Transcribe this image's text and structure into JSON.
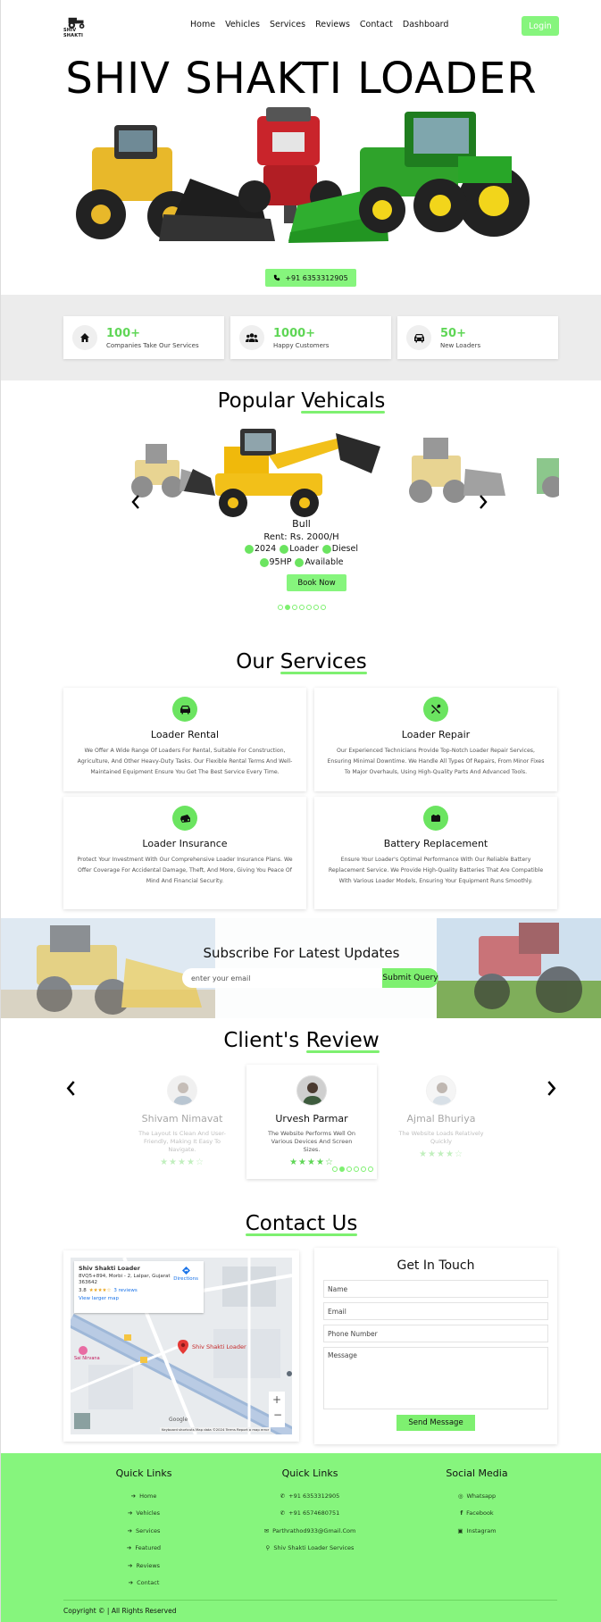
{
  "brand": {
    "logo_text": "SHIV SHAKTI"
  },
  "nav": {
    "items": [
      {
        "label": "Home"
      },
      {
        "label": "Vehicles"
      },
      {
        "label": "Services"
      },
      {
        "label": "Reviews"
      },
      {
        "label": "Contact"
      },
      {
        "label": "Dashboard"
      }
    ],
    "login_label": "Login"
  },
  "hero": {
    "title": "SHIV SHAKTI LOADER",
    "phone": "+91 6353312905"
  },
  "stats": [
    {
      "icon": "home-icon",
      "value": "100+",
      "label": "Companies Take Our Services"
    },
    {
      "icon": "users-icon",
      "value": "1000+",
      "label": "Happy Customers"
    },
    {
      "icon": "car-icon",
      "value": "50+",
      "label": "New Loaders"
    }
  ],
  "vehicles": {
    "title_a": "Popular",
    "title_b": "Vehicals",
    "current": {
      "name": "Bull",
      "rent": "Rent: Rs. 2000/H",
      "tags_row1": [
        "2024",
        "Loader",
        "Diesel"
      ],
      "tags_row2": [
        "95HP",
        "Available"
      ]
    },
    "book_label": "Book Now",
    "indicator_count": 7,
    "active_indicator": 1
  },
  "services": {
    "title_a": "Our",
    "title_b": "Services",
    "items": [
      {
        "icon": "car-icon",
        "title": "Loader Rental",
        "desc": "We Offer A Wide Range Of Loaders For Rental, Suitable For Construction, Agriculture, And Other Heavy-Duty Tasks. Our Flexible Rental Terms And Well-Maintained Equipment Ensure You Get The Best Service Every Time."
      },
      {
        "icon": "tools-icon",
        "title": "Loader Repair",
        "desc": "Our Experienced Technicians Provide Top-Notch Loader Repair Services, Ensuring Minimal Downtime. We Handle All Types Of Repairs, From Minor Fixes To Major Overhauls, Using High-Quality Parts And Advanced Tools."
      },
      {
        "icon": "car-crash-icon",
        "title": "Loader Insurance",
        "desc": "Protect Your Investment With Our Comprehensive Loader Insurance Plans. We Offer Coverage For Accidental Damage, Theft, And More, Giving You Peace Of Mind And Financial Security."
      },
      {
        "icon": "battery-icon",
        "title": "Battery Replacement",
        "desc": "Ensure Your Loader's Optimal Performance With Our Reliable Battery Replacement Service. We Provide High-Quality Batteries That Are Compatible With Various Loader Models, Ensuring Your Equipment Runs Smoothly."
      }
    ]
  },
  "subscribe": {
    "title": "Subscribe For Latest Updates",
    "placeholder": "enter your email",
    "button": "Submit Query"
  },
  "reviews": {
    "title_a": "Client's",
    "title_b": "Review",
    "items": [
      {
        "name": "Shivam Nimavat",
        "text": "The Layout Is Clean And User-Friendly, Making It Easy To Navigate.",
        "stars": "★★★★☆"
      },
      {
        "name": "Urvesh Parmar",
        "text": "The Website Performs Well On Various Devices And Screen Sizes.",
        "stars": "★★★★☆"
      },
      {
        "name": "Ajmal Bhuriya",
        "text": "The Website Loads Relatively Quickly",
        "stars": "★★★★☆"
      }
    ],
    "indicator_count": 6,
    "active_indicator": 1
  },
  "contact": {
    "title": "Contact Us",
    "map": {
      "place": "Shiv Shakti Loader",
      "address": "8VQ5+894, Morbi - 2, Lalpar, Gujarat 363642",
      "rating": "3.8",
      "rating_stars": "★★★★☆",
      "reviews": "3 reviews",
      "directions": "Directions",
      "larger_map": "View larger map",
      "pin_label": "Shiv Shakti Loader",
      "nearby_label": "Sai Nirvana",
      "footer_text": "Keyboard shortcuts   Map data ©2024   Terms   Report a map error",
      "google": "Google"
    },
    "form": {
      "title": "Get In Touch",
      "name_placeholder": "Name",
      "email_placeholder": "Email",
      "phone_placeholder": "Phone Number",
      "message_placeholder": "Message",
      "send_label": "Send Message"
    }
  },
  "footer": {
    "col1": {
      "title": "Quick Links",
      "items": [
        "Home",
        "Vehicles",
        "Services",
        "Featured",
        "Reviews",
        "Contact"
      ]
    },
    "col2": {
      "title": "Quick Links",
      "items": [
        "+91 6353312905",
        "+91 6574680751",
        "Parthrathod933@Gmail.Com",
        "Shiv Shakti Loader Services"
      ]
    },
    "col3": {
      "title": "Social Media",
      "items": [
        "Whatsapp",
        "Facebook",
        "Instagram"
      ]
    },
    "copyright": "Copyright © | All Rights Reserved"
  },
  "colors": {
    "accent": "#86f57d",
    "accent_dark": "#5fd656"
  }
}
